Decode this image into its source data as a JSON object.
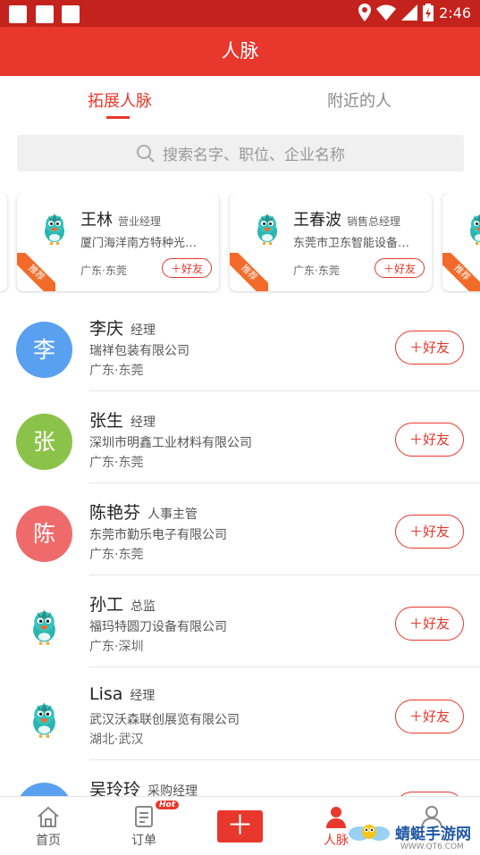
{
  "status_bar": {
    "time": "2:46",
    "icons": [
      "location-icon",
      "wifi-icon",
      "signal-icon",
      "battery-icon"
    ]
  },
  "header": {
    "title": "人脉"
  },
  "tabs": [
    {
      "label": "拓展人脉",
      "active": true
    },
    {
      "label": "附近的人",
      "active": false
    }
  ],
  "search": {
    "placeholder": "搜索名字、职位、企业名称"
  },
  "recommended": [
    {
      "name": "王林",
      "title": "营业经理",
      "company": "厦门海洋南方特种光…",
      "location": "广东·东莞",
      "button": "好友",
      "badge": "推荐"
    },
    {
      "name": "王春波",
      "title": "销售总经理",
      "company": "东莞市卫东智能设备…",
      "location": "广东·东莞",
      "button": "好友",
      "badge": "推荐"
    }
  ],
  "contacts": [
    {
      "avatar_text": "李",
      "avatar_color": "#5aa0f0",
      "name": "李庆",
      "title": "经理",
      "company": "瑞祥包装有限公司",
      "location": "广东·东莞",
      "button": "好友"
    },
    {
      "avatar_text": "张",
      "avatar_color": "#8bc34a",
      "name": "张生",
      "title": "经理",
      "company": "深圳市明鑫工业材料有限公司",
      "location": "广东·东莞",
      "button": "好友"
    },
    {
      "avatar_text": "陈",
      "avatar_color": "#ef6b6b",
      "name": "陈艳芬",
      "title": "人事主管",
      "company": "东莞市勤乐电子有限公司",
      "location": "广东·东莞",
      "button": "好友"
    },
    {
      "avatar_text": "",
      "avatar_color": "",
      "name": "孙工",
      "title": "总监",
      "company": "福玛特圆刀设备有限公司",
      "location": "广东·深圳",
      "button": "好友"
    },
    {
      "avatar_text": "",
      "avatar_color": "",
      "name": "Lisa",
      "title": "经理",
      "company": "武汉沃森联创展览有限公司",
      "location": "湖北·武汉",
      "button": "好友"
    },
    {
      "avatar_text": "",
      "avatar_color": "#5aa0f0",
      "name": "吴玲玲",
      "title": "采购经理",
      "company": "",
      "location": "",
      "button": ""
    }
  ],
  "bottom_nav": [
    {
      "label": "首页",
      "icon": "home-icon"
    },
    {
      "label": "订单",
      "icon": "order-icon",
      "badge": "Hot"
    },
    {
      "label": "",
      "icon": "plus-icon"
    },
    {
      "label": "人脉",
      "icon": "contacts-icon",
      "active": true
    },
    {
      "label": "",
      "icon": "profile-icon"
    }
  ],
  "watermark": {
    "text": "蜻蜓手游网",
    "url": "WWW.QT6.COM"
  },
  "colors": {
    "brand_red": "#e8372c",
    "status_red": "#c4221c",
    "ribbon_orange": "#f36b2a"
  }
}
